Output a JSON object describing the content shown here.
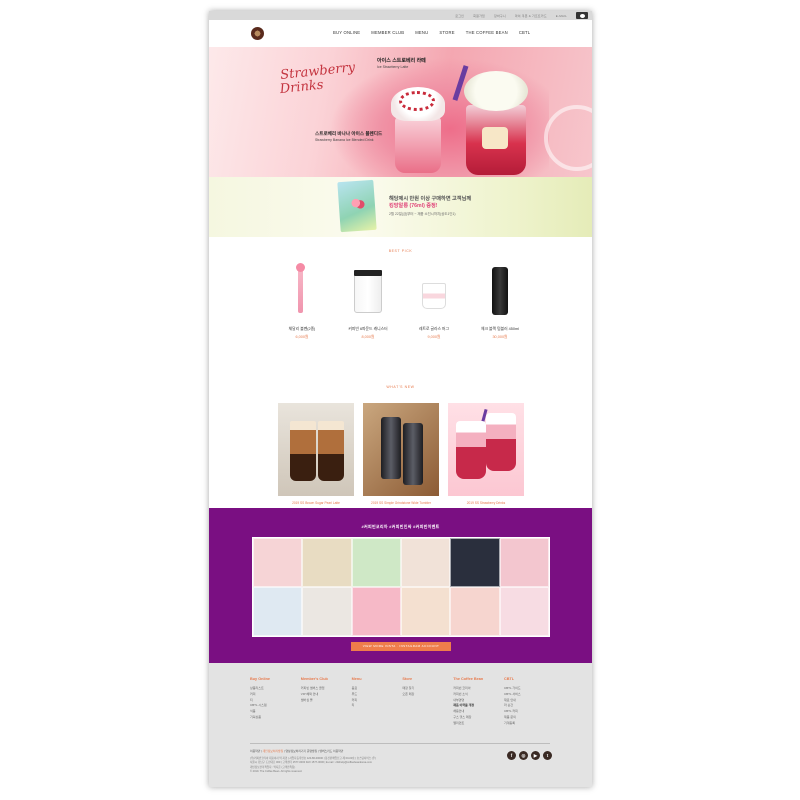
{
  "topbar": {
    "links": [
      "로그인",
      "회원가입",
      "장바구니",
      "마이 쿠폰 & 기프트카드",
      "E-MAIL"
    ]
  },
  "nav": {
    "items": [
      "BUY ONLINE",
      "MEMBER CLUB",
      "MENU",
      "STORE",
      "THE COFFEE BEAN",
      "CBTL"
    ]
  },
  "hero": {
    "script_line1": "Strawberry",
    "script_line2": "Drinks",
    "top_title": "아이스 스트로베리 라떼",
    "top_sub": "Ice Strawberry Latte",
    "bottom_title": "스트로베리 바나나 아이스 블렌디드",
    "bottom_sub": "Strawberry Banana Ice Blended Drink"
  },
  "promo": {
    "line1": "해당제시 만원 이상 구매하면 고객님께",
    "line2": "킹망알롱 (76ml) 증정!",
    "line3": "2월 22일(금)부터 ~ 재품 소진시까지(상도1인1)"
  },
  "best_pick": {
    "title": "BEST PICK",
    "items": [
      {
        "name": "체달리 볼펜(2종)",
        "price": "6,000원"
      },
      {
        "name": "커피빈 6파운드 캐니스터",
        "price": "8,000원"
      },
      {
        "name": "레트로 글라스 머그",
        "price": "9,000원"
      },
      {
        "name": "체크 블랙 텀블러 450ml",
        "price": "30,000원"
      }
    ]
  },
  "whats_new": {
    "title": "WHAT'S NEW",
    "items": [
      {
        "caption": "2019 SS Brown Sugar Pearl Latte"
      },
      {
        "caption": "2019 SS Simple Grindstone Wide Tumbler"
      },
      {
        "caption": "2019 SS Strawberry Drinks"
      }
    ]
  },
  "instagram": {
    "title": "#커피빈코리아 #커피빈인싸 #커피빈이벤트",
    "button": "VIEW MORE INSTA · INSTAGRAM ACCOUNT",
    "tile_colors": [
      "#f6d4d6",
      "#e8dcc2",
      "#cfe8c6",
      "#f1e2d8",
      "#2a2f3d",
      "#f3c6cf",
      "#dfe9f2",
      "#ebe7e2",
      "#f6b9c7",
      "#f4e0d0",
      "#f6d5cf",
      "#f7dce3"
    ]
  },
  "footer": {
    "columns": [
      {
        "heading": "Buy Online",
        "items": [
          "상품리스트",
          "커피",
          "티",
          "CBTL 시스템",
          "식품",
          "기획상품"
        ],
        "bold_index": -1
      },
      {
        "heading": "Member's Club",
        "items": [
          "커피빈 멤버스 클럽",
          "VIP 혜택 안내",
          "멤버십 몰"
        ],
        "bold_index": -1
      },
      {
        "heading": "Menu",
        "items": [
          "음료",
          "푸드",
          "커피",
          "티"
        ],
        "bold_index": -1
      },
      {
        "heading": "Store",
        "items": [
          "매장 찾기",
          "오픈 매장"
        ],
        "bold_index": -1
      },
      {
        "heading": "The Coffee Bean",
        "items": [
          "커피빈 코리아",
          "커피빈 소식",
          "내부경영",
          "재품 이력을 개정",
          "채용안내",
          "구스 헬스 매장",
          "엘리먼트"
        ],
        "bold_index": 3
      },
      {
        "heading": "CBTL",
        "items": [
          "CBTL 가이드",
          "CBTL 서비스",
          "재료 안내",
          "라 순간",
          "CBTL 커피",
          "제품 문의",
          "기계등록"
        ],
        "bold_index": -1
      }
    ],
    "links": [
      "이용약관",
      "개인정보처리방침",
      "영상정보처리기기 운영방침",
      "멤버스카드 이용약관"
    ],
    "highlight_link_index": 1,
    "info_lines": [
      "(주)커피빈코리아 대표이사 박 지경 | 사업자등록번호 120-86-00000 | 통신판매업신고 제 00-00호 | 호스팅서비스 (주)",
      "서울시 강남구 도산대로 000 | 고객센터 1577-0000 FAX 1577-0000 | E-mail : cbkhelp@coffeebeankorea.com",
      "개인정보관리책임자 : 박지훈 (고객만족팀)",
      "© 2019. The Coffee Bean. All rights reserved."
    ],
    "social": [
      "f",
      "◎",
      "▶",
      "t"
    ]
  }
}
